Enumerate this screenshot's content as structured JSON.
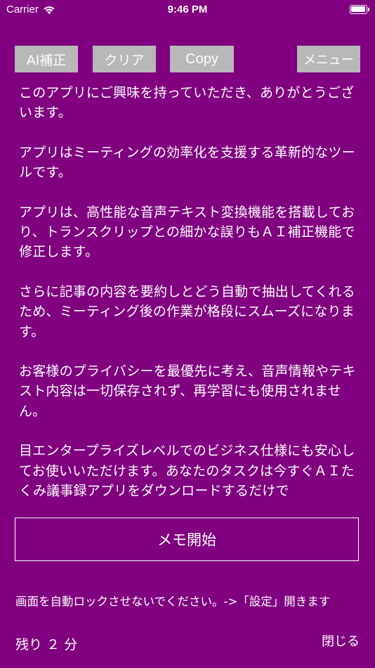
{
  "theme": {
    "background": "#800080",
    "button_gray": "#b8b8b8"
  },
  "status_bar": {
    "carrier": "Carrier",
    "time": "9:46 PM",
    "icons": [
      "wifi-icon",
      "battery-icon"
    ]
  },
  "toolbar": {
    "ai_label": "AI補正",
    "clear_label": "クリア",
    "copy_label": "Copy",
    "menu_label": "メニュー"
  },
  "content": {
    "text": "このアプリにご興味を持っていただき、ありがとうございます。\n\nアプリはミーティングの効率化を支援する革新的なツールです。\n\nアプリは、高性能な音声テキスト変換機能を搭載しており、トランスクリップとの細かな誤りもＡＩ補正機能で修正します。\n\nさらに記事の内容を要約しとどう自動で抽出してくれるため、ミーティング後の作業が格段にスムーズになります。\n\nお客様のプライバシーを最優先に考え、音声情報やテキスト内容は一切保存されず、再学習にも使用されません。\n\n目エンタープライズレベルでのビジネス仕様にも安心してお使いいただけます。あなたのタスクは今すぐＡＩたくみ議事録アプリをダウンロードするだけで"
  },
  "start_memo_label": "メモ開始",
  "notice": "画面を自動ロックさせないでください。->「設定」開きます",
  "remaining_time": "残り ２ 分",
  "close_label": "閉じる"
}
